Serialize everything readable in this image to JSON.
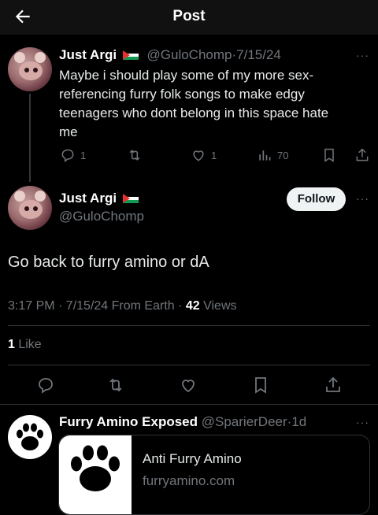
{
  "header": {
    "title": "Post"
  },
  "reply_to": {
    "display_name": "Just Argi",
    "handle": "@GuloChomp",
    "date": "7/15/24",
    "text_lines": [
      "Maybe i should play some of my more sex-",
      "referencing furry folk songs to make edgy",
      "teenagers who dont belong in this space hate",
      "me"
    ],
    "replies": "1",
    "likes": "1",
    "views": "70"
  },
  "main_post": {
    "display_name": "Just Argi",
    "handle": "@GuloChomp",
    "follow_label": "Follow",
    "text": "Go back to furry amino or dA",
    "time_date": "3:17 PM · 7/15/24 From Earth · ",
    "views_count": "42",
    "views_label": " Views",
    "likes_count": "1",
    "likes_label": " Like"
  },
  "reply": {
    "display_name": "Furry Amino Exposed",
    "handle": "@SparierDeer",
    "age": "1d",
    "card": {
      "title": "Anti Furry Amino",
      "domain": "furryamino.com"
    }
  },
  "colors": {
    "bg": "#000000",
    "muted": "#71767b",
    "divider": "#2f3336"
  }
}
